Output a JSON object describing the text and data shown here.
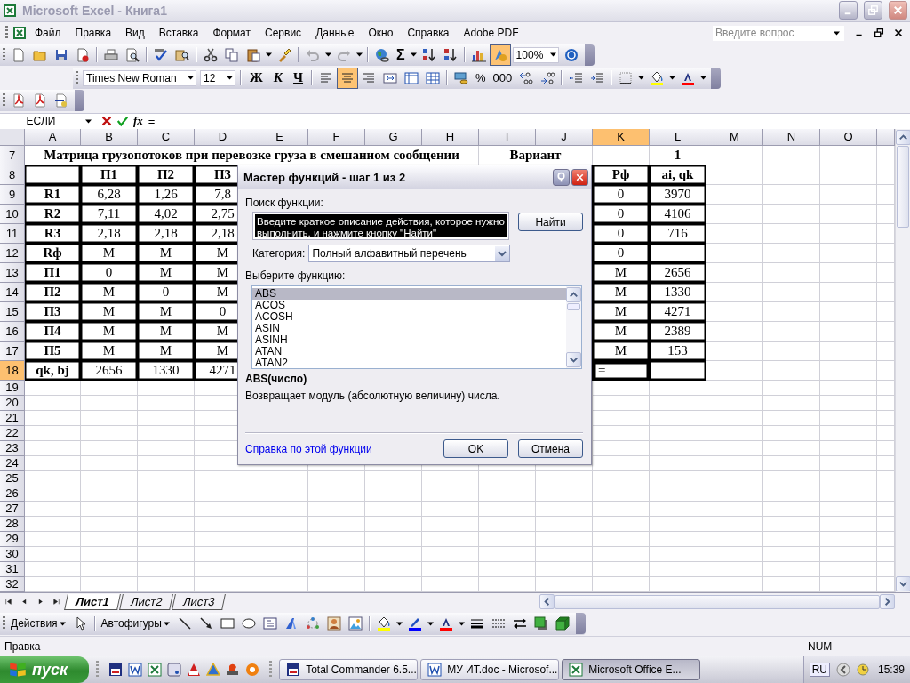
{
  "window": {
    "title": "Microsoft Excel - Книга1"
  },
  "menu": {
    "items": [
      "Файл",
      "Правка",
      "Вид",
      "Вставка",
      "Формат",
      "Сервис",
      "Данные",
      "Окно",
      "Справка",
      "Adobe PDF"
    ],
    "help_placeholder": "Введите вопрос"
  },
  "standard_toolbar": {
    "undo_disabled": true,
    "redo_disabled": true,
    "sum_label": "Σ",
    "drawing_selected": true,
    "zoom": "100%"
  },
  "formatting_toolbar": {
    "font": "Times New Roman",
    "size": "12",
    "style_buttons": [
      "Ж",
      "К",
      "Ч"
    ],
    "align_buttons": [
      {
        "selected": false
      },
      {
        "selected": true
      },
      {
        "selected": false
      }
    ],
    "percent": "%",
    "thousands": "000"
  },
  "formula_bar": {
    "name_box": "ЕСЛИ",
    "fx": "fx",
    "formula": "="
  },
  "sheet": {
    "columns": [
      {
        "label": "A",
        "selected": false
      },
      {
        "label": "B",
        "selected": false
      },
      {
        "label": "C",
        "selected": false
      },
      {
        "label": "D",
        "selected": false
      },
      {
        "label": "E",
        "selected": false
      },
      {
        "label": "F",
        "selected": false
      },
      {
        "label": "G",
        "selected": false
      },
      {
        "label": "H",
        "selected": false
      },
      {
        "label": "I",
        "selected": false
      },
      {
        "label": "J",
        "selected": false
      },
      {
        "label": "K",
        "selected": true
      },
      {
        "label": "L",
        "selected": false
      },
      {
        "label": "M",
        "selected": false
      },
      {
        "label": "N",
        "selected": false
      },
      {
        "label": "O",
        "selected": false
      }
    ],
    "rows": [
      {
        "number": "7",
        "selected": false,
        "kind": "title",
        "title": "Матрица грузопотоков при перевозке груза в смешанном сообщении",
        "variant_label": "Вариант",
        "variant_value": "1"
      },
      {
        "number": "8",
        "selected": false,
        "kind": "table",
        "bold": true,
        "cells": [
          null,
          "П1",
          "П2",
          "П3",
          null,
          null,
          null,
          null,
          null,
          null,
          "Рф",
          "ai, qk"
        ]
      },
      {
        "number": "9",
        "selected": false,
        "kind": "table",
        "bold": false,
        "cells": [
          "R1",
          "6,28",
          "1,26",
          "7,8",
          null,
          null,
          null,
          null,
          null,
          null,
          "0",
          "3970"
        ]
      },
      {
        "number": "10",
        "selected": false,
        "kind": "table",
        "bold": false,
        "cells": [
          "R2",
          "7,11",
          "4,02",
          "2,75",
          null,
          null,
          null,
          null,
          null,
          null,
          "0",
          "4106"
        ]
      },
      {
        "number": "11",
        "selected": false,
        "kind": "table",
        "bold": false,
        "cells": [
          "R3",
          "2,18",
          "2,18",
          "2,18",
          null,
          null,
          null,
          null,
          null,
          null,
          "0",
          "716"
        ]
      },
      {
        "number": "12",
        "selected": false,
        "kind": "table",
        "bold": false,
        "cells": [
          "Rф",
          "М",
          "М",
          "М",
          null,
          null,
          null,
          null,
          null,
          null,
          "0",
          null
        ]
      },
      {
        "number": "13",
        "selected": false,
        "kind": "table",
        "bold": false,
        "cells": [
          "П1",
          "0",
          "М",
          "М",
          null,
          null,
          null,
          null,
          null,
          null,
          "М",
          "2656"
        ]
      },
      {
        "number": "14",
        "selected": false,
        "kind": "table",
        "bold": false,
        "cells": [
          "П2",
          "М",
          "0",
          "М",
          null,
          null,
          null,
          null,
          null,
          null,
          "М",
          "1330"
        ]
      },
      {
        "number": "15",
        "selected": false,
        "kind": "table",
        "bold": false,
        "cells": [
          "П3",
          "М",
          "М",
          "0",
          null,
          null,
          null,
          null,
          null,
          null,
          "М",
          "4271"
        ]
      },
      {
        "number": "16",
        "selected": false,
        "kind": "table",
        "bold": false,
        "cells": [
          "П4",
          "М",
          "М",
          "М",
          null,
          null,
          null,
          null,
          null,
          null,
          "М",
          "2389"
        ]
      },
      {
        "number": "17",
        "selected": false,
        "kind": "table",
        "bold": false,
        "cells": [
          "П5",
          "М",
          "М",
          "М",
          null,
          null,
          null,
          null,
          null,
          null,
          "М",
          "153"
        ]
      },
      {
        "number": "18",
        "selected": true,
        "kind": "table",
        "bold": false,
        "cells": [
          "qk, bj",
          "2656",
          "1330",
          "4271",
          null,
          null,
          null,
          null,
          null,
          null,
          "=",
          null
        ]
      },
      {
        "number": "19",
        "selected": false,
        "kind": "blank"
      },
      {
        "number": "20",
        "selected": false,
        "kind": "blank"
      },
      {
        "number": "21",
        "selected": false,
        "kind": "blank"
      },
      {
        "number": "22",
        "selected": false,
        "kind": "blank"
      },
      {
        "number": "23",
        "selected": false,
        "kind": "blank"
      },
      {
        "number": "24",
        "selected": false,
        "kind": "blank"
      },
      {
        "number": "25",
        "selected": false,
        "kind": "blank"
      },
      {
        "number": "26",
        "selected": false,
        "kind": "blank"
      },
      {
        "number": "27",
        "selected": false,
        "kind": "blank"
      },
      {
        "number": "28",
        "selected": false,
        "kind": "blank"
      },
      {
        "number": "29",
        "selected": false,
        "kind": "blank"
      },
      {
        "number": "30",
        "selected": false,
        "kind": "blank"
      },
      {
        "number": "31",
        "selected": false,
        "kind": "blank"
      },
      {
        "number": "32",
        "selected": false,
        "kind": "blank"
      }
    ]
  },
  "sheet_tabs": [
    {
      "label": "Лист1",
      "selected": true
    },
    {
      "label": "Лист2",
      "selected": false
    },
    {
      "label": "Лист3",
      "selected": false
    }
  ],
  "dialog": {
    "title": "Мастер функций - шаг 1 из 2",
    "search_label": "Поиск функции:",
    "search_text": "Введите краткое описание действия, которое нужно выполнить, и нажмите кнопку \"Найти\"",
    "search_text_selected": true,
    "find_button": "Найти",
    "category_label": "Категория:",
    "category": "Полный алфавитный перечень",
    "list_label": "Выберите функцию:",
    "functions": [
      {
        "name": "ABS",
        "selected": true
      },
      {
        "name": "ACOS",
        "selected": false
      },
      {
        "name": "ACOSH",
        "selected": false
      },
      {
        "name": "ASIN",
        "selected": false
      },
      {
        "name": "ASINH",
        "selected": false
      },
      {
        "name": "ATAN",
        "selected": false
      },
      {
        "name": "ATAN2",
        "selected": false
      }
    ],
    "signature": "ABS(число)",
    "description": "Возвращает модуль (абсолютную величину) числа.",
    "help_link": "Справка по этой функции",
    "ok": "OK",
    "cancel": "Отмена"
  },
  "drawing_toolbar": {
    "actions": "Действия",
    "autoshapes": "Автофигуры"
  },
  "status_bar": {
    "text": "Правка",
    "num": "NUM"
  },
  "taskbar": {
    "start": "пуск",
    "buttons": [
      {
        "label": "Total Commander 6.5...",
        "selected": false
      },
      {
        "label": "МУ ИТ.doc - Microsof...",
        "selected": false
      },
      {
        "label": "Microsoft Office E...",
        "selected": true
      }
    ],
    "language": "RU",
    "clock": "15:39"
  }
}
